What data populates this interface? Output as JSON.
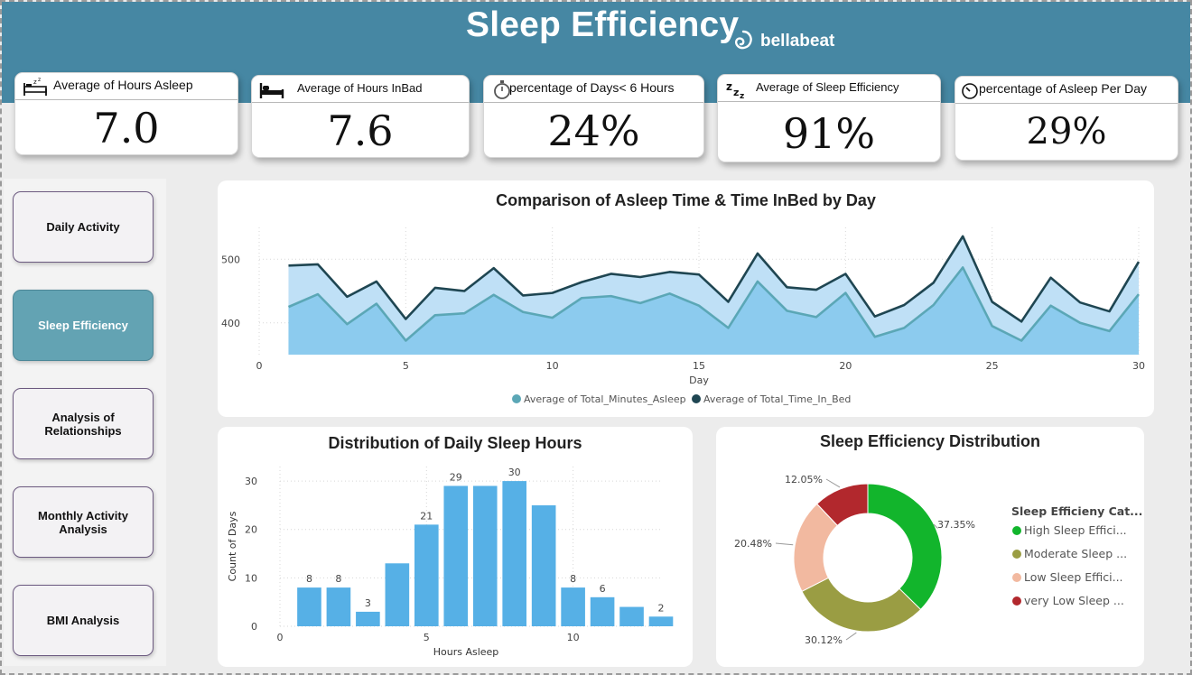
{
  "header": {
    "title": "Sleep Efficiency",
    "brand": "bellabeat"
  },
  "kpis": [
    {
      "label": "Average of Hours Asleep",
      "value": "7.0",
      "icon": "bed-zz-icon"
    },
    {
      "label": "Average of Hours InBad",
      "value": "7.6",
      "icon": "bed-icon"
    },
    {
      "label": "percentage of Days< 6 Hours",
      "value": "24%",
      "icon": "stopwatch-icon"
    },
    {
      "label": "Average of Sleep Efficiency",
      "value": "91%",
      "icon": "zzz-icon"
    },
    {
      "label": "percentage of Asleep Per Day",
      "value": "29%",
      "icon": "clock-icon"
    }
  ],
  "nav": [
    {
      "label": "Daily Activity",
      "active": false
    },
    {
      "label": "Sleep Efficiency",
      "active": true
    },
    {
      "label": "Analysis of Relationships",
      "active": false
    },
    {
      "label": "Monthly Activity Analysis",
      "active": false
    },
    {
      "label": "BMI Analysis",
      "active": false
    }
  ],
  "colors": {
    "header": "#4687a3",
    "asleep": "#5ba7b6",
    "inbed": "#1f4652",
    "bar": "#56b0e6",
    "donut_high": "#12b52c",
    "donut_moderate": "#9a9d43",
    "donut_low": "#f2b9a0",
    "donut_very_low": "#b2282d"
  },
  "chart_data": [
    {
      "type": "area",
      "title": "Comparison of Asleep Time & Time InBed by Day",
      "xlabel": "Day",
      "ylabel": "",
      "xlim": [
        0,
        30
      ],
      "ylim": [
        350,
        550
      ],
      "x_ticks": [
        0,
        5,
        10,
        15,
        20,
        25,
        30
      ],
      "y_ticks": [
        400,
        500
      ],
      "grid": true,
      "legend_position": "bottom",
      "x": [
        1,
        2,
        3,
        4,
        5,
        6,
        7,
        8,
        9,
        10,
        11,
        12,
        13,
        14,
        15,
        16,
        17,
        18,
        19,
        20,
        21,
        22,
        23,
        24,
        25,
        26,
        27,
        28,
        29,
        30
      ],
      "series": [
        {
          "name": "Average of Total_Minutes_Asleep",
          "values": [
            425,
            445,
            398,
            430,
            372,
            412,
            415,
            444,
            417,
            408,
            439,
            442,
            431,
            446,
            427,
            392,
            465,
            419,
            409,
            447,
            378,
            392,
            428,
            487,
            395,
            372,
            427,
            400,
            387,
            445
          ]
        },
        {
          "name": "Average of Total_Time_In_Bed",
          "values": [
            490,
            492,
            441,
            465,
            406,
            455,
            450,
            486,
            443,
            447,
            464,
            477,
            472,
            480,
            476,
            433,
            509,
            456,
            452,
            477,
            410,
            428,
            463,
            536,
            433,
            402,
            471,
            432,
            418,
            496
          ]
        }
      ]
    },
    {
      "type": "bar",
      "title": "Distribution of Daily Sleep Hours",
      "xlabel": "Hours Asleep",
      "ylabel": "Count of Days",
      "xlim": [
        0,
        13
      ],
      "ylim": [
        0,
        33
      ],
      "x_ticks": [
        0,
        5,
        10
      ],
      "y_ticks": [
        0,
        10,
        20,
        30
      ],
      "grid": true,
      "x": [
        1,
        2,
        3,
        4,
        5,
        6,
        7,
        8,
        9,
        10,
        11,
        12,
        13
      ],
      "values": [
        8,
        8,
        3,
        13,
        21,
        29,
        29,
        30,
        25,
        8,
        6,
        4,
        2
      ],
      "data_labels": [
        "8",
        "8",
        "3",
        "",
        "21",
        "29",
        "",
        "30",
        "",
        "8",
        "6",
        "",
        "2"
      ]
    },
    {
      "type": "pie",
      "title": "Sleep Efficiency Distribution",
      "legend_title": "Sleep Efficieny Cat...",
      "legend_position": "right",
      "labels": [
        "High Sleep Effici...",
        "Moderate Sleep ...",
        "Low Sleep Effici...",
        "very Low Sleep ..."
      ],
      "values": [
        37.35,
        30.12,
        20.48,
        12.05
      ],
      "value_labels": [
        "37.35%",
        "30.12%",
        "20.48%",
        "12.05%"
      ]
    }
  ]
}
